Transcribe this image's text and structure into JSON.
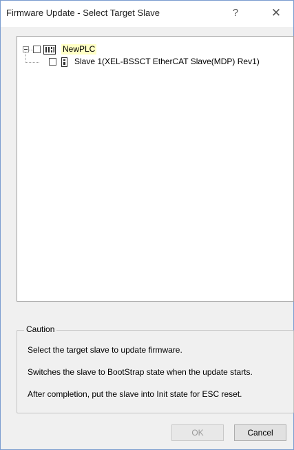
{
  "window": {
    "title": "Firmware Update - Select Target Slave",
    "help_glyph": "?",
    "close_glyph": "✕"
  },
  "tree": {
    "root": {
      "label": "NewPLC",
      "expanded": true,
      "checked": false,
      "highlight_color": "#ffffc4"
    },
    "children": [
      {
        "label": "Slave  1(XEL-BSSCT EtherCAT Slave(MDP) Rev1)",
        "checked": false
      }
    ]
  },
  "caution": {
    "title": "Caution",
    "lines": [
      "Select the target slave to update firmware.",
      "Switches the slave to BootStrap state when the update starts.",
      "After completion, put the slave into Init state for ESC reset."
    ]
  },
  "buttons": {
    "ok": {
      "label": "OK",
      "enabled": false
    },
    "cancel": {
      "label": "Cancel",
      "enabled": true
    }
  }
}
